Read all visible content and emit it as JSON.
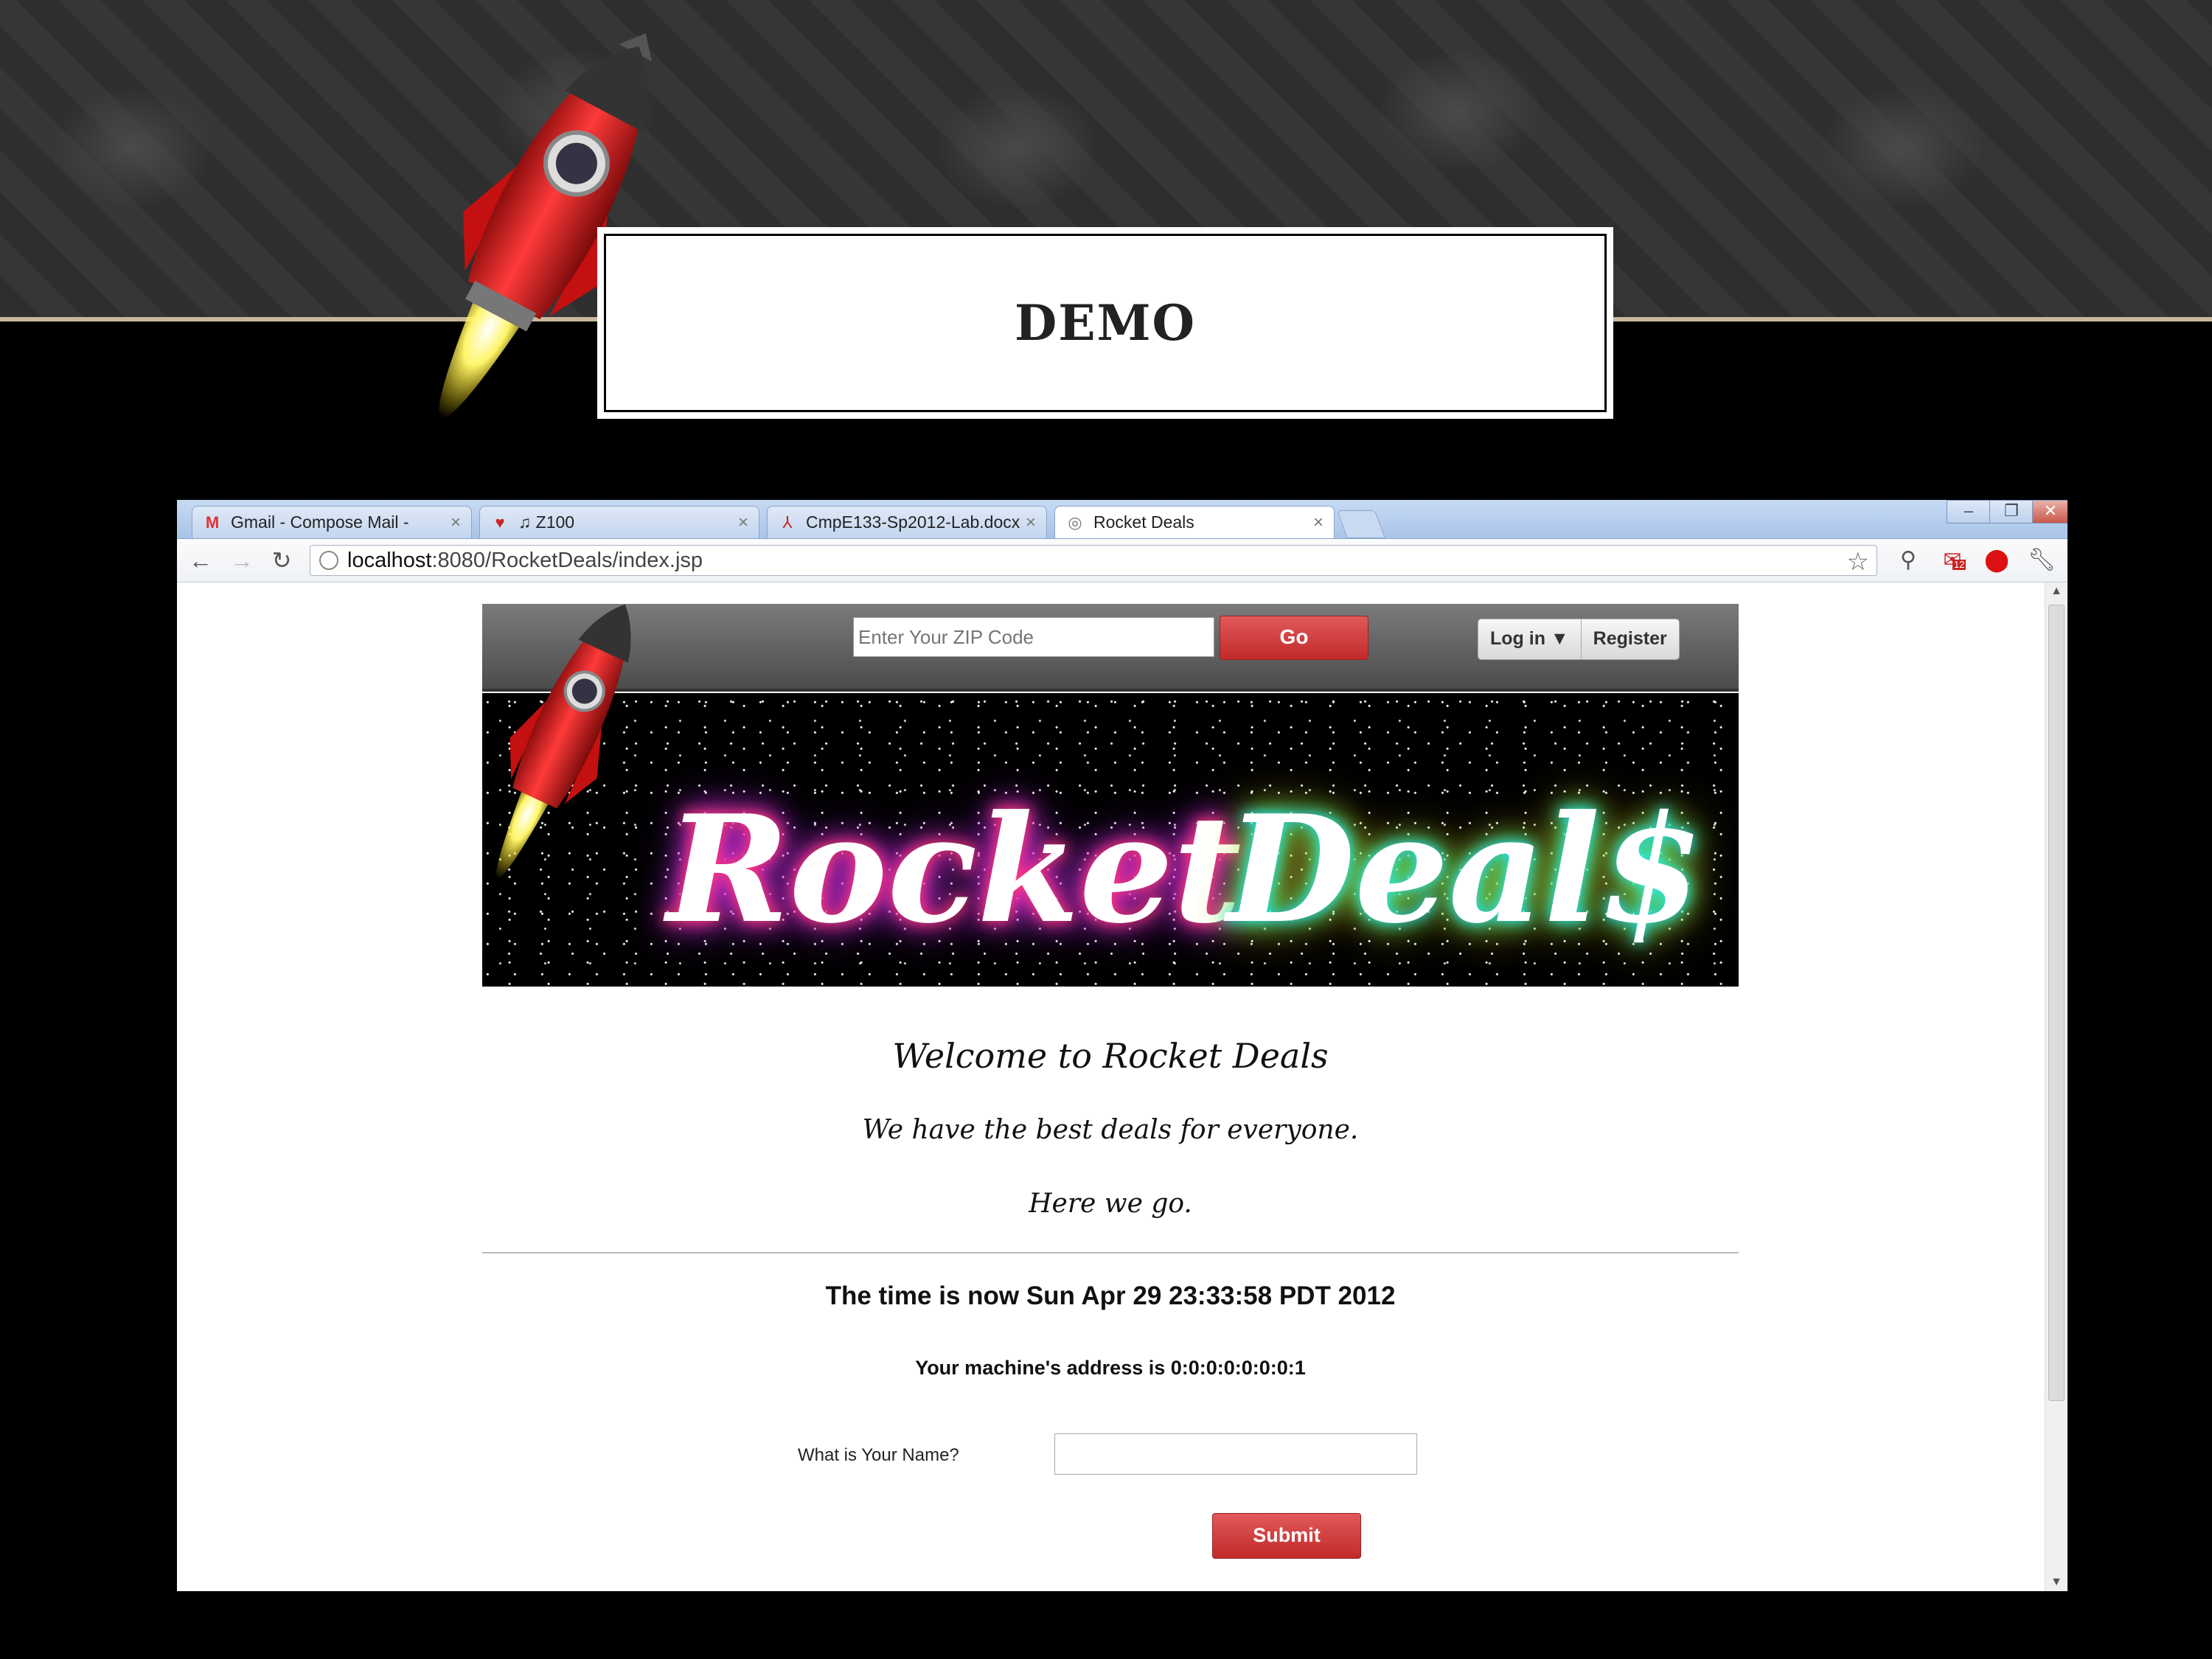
{
  "slide": {
    "title": "DEMO"
  },
  "browser": {
    "tabs": [
      {
        "label": "Gmail - Compose Mail -",
        "icon": "gmail-icon"
      },
      {
        "label": "♫ Z100",
        "icon": "iheart-icon"
      },
      {
        "label": "CmpE133-Sp2012-Lab.docx",
        "icon": "pdf-icon"
      },
      {
        "label": "Rocket Deals",
        "icon": "globe-icon",
        "active": true
      }
    ],
    "url_host": "localhost",
    "url_rest": ":8080/RocketDeals/index.jsp",
    "mail_badge": "12"
  },
  "site": {
    "zip_placeholder": "Enter Your ZIP Code",
    "go_label": "Go",
    "login_label": "Log in ▼",
    "register_label": "Register",
    "banner_word1": "Rocket",
    "banner_word2": "Deal$",
    "welcome": "Welcome to Rocket Deals",
    "tagline": "We have the best deals for everyone.",
    "here": "Here we go.",
    "time_text": "The time is now Sun Apr 29 23:33:58 PDT 2012",
    "address_text": "Your machine's address is 0:0:0:0:0:0:0:1",
    "name_label": "What is Your Name?",
    "name_value": "",
    "submit_label": "Submit"
  },
  "colors": {
    "accent_red": "#d13b3b",
    "tab_blue": "#b7cff0"
  }
}
